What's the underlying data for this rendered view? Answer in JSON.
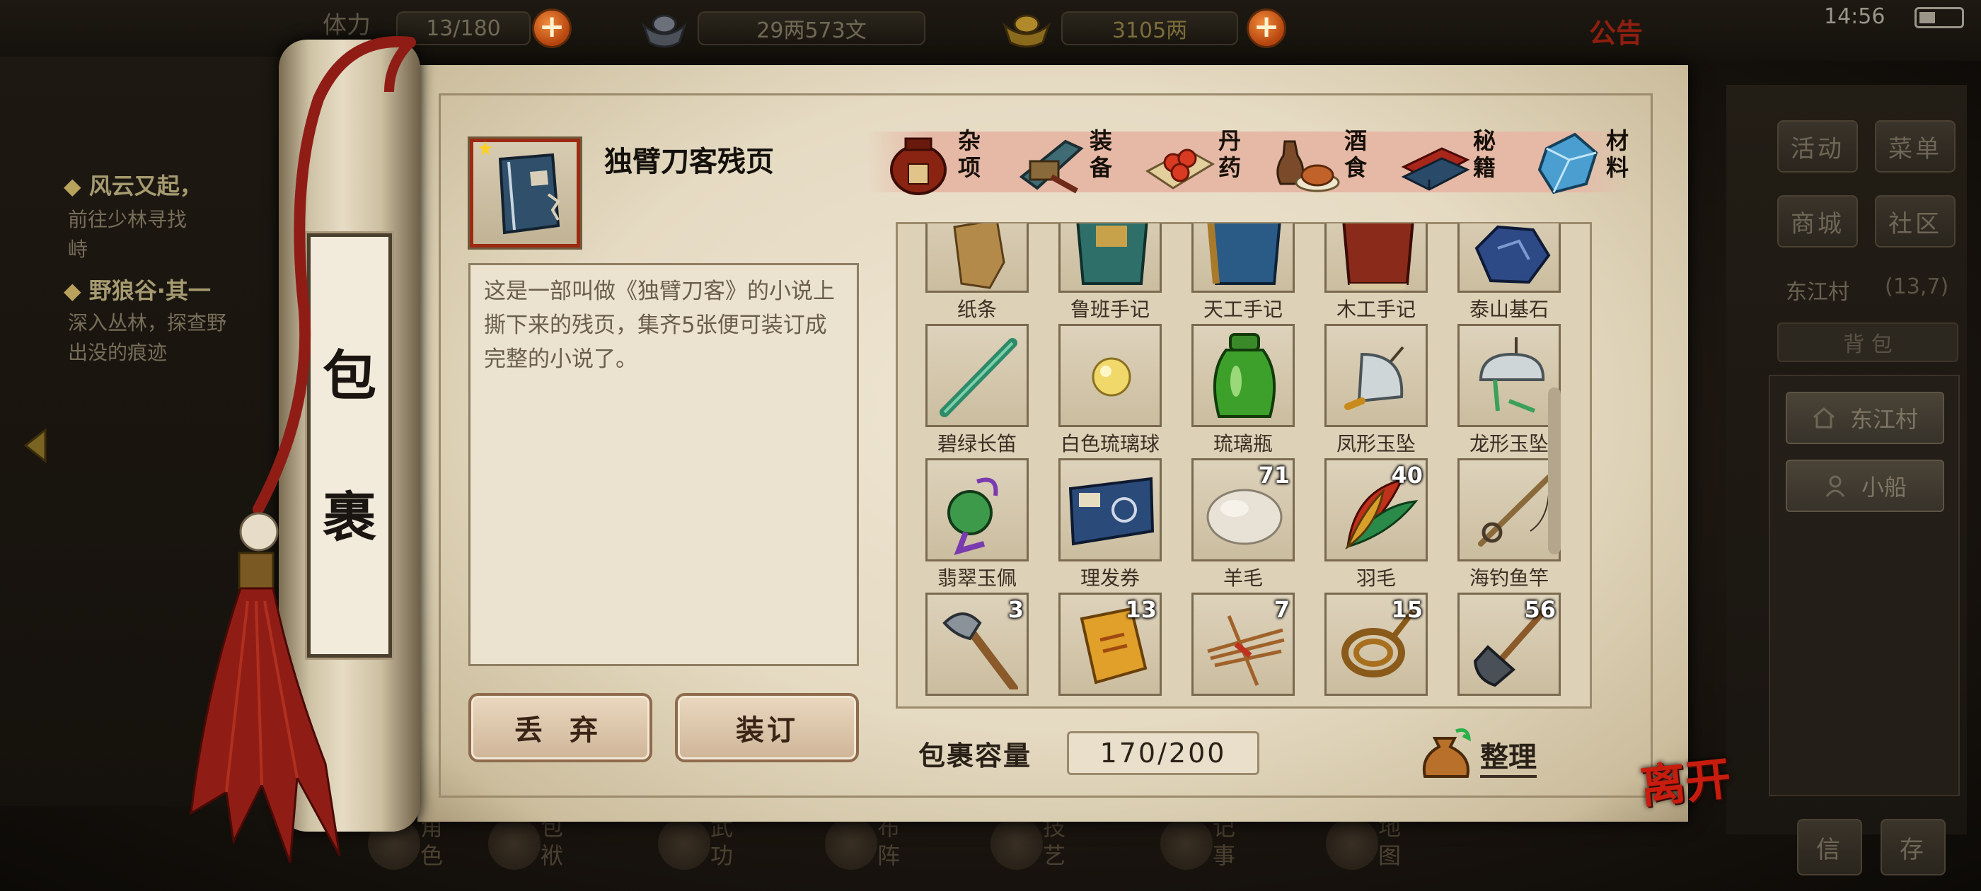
{
  "topbar": {
    "stamina_label": "体力",
    "stamina_value": "13/180",
    "silver_value": "29两573文",
    "gold_value": "3105两",
    "announcement": "公告",
    "time": "14:56"
  },
  "quests": [
    {
      "title": "风云又起，",
      "desc_lines": [
        "前往少林寻找",
        "峙"
      ]
    },
    {
      "title": "野狼谷·其一",
      "desc_lines": [
        "深入丛林，探查野",
        "出没的痕迹"
      ]
    }
  ],
  "side_panel": {
    "buttons": [
      "活动",
      "菜单",
      "商城",
      "社区"
    ],
    "location": "东江村",
    "coords": "(13,7)",
    "hint": "背 包",
    "places": [
      "东江村",
      "小船"
    ],
    "bottom_buttons": [
      "信",
      "存"
    ]
  },
  "bag": {
    "title_chars": [
      "包",
      "裹"
    ],
    "selected_item": {
      "name": "独臂刀客残页",
      "description": "这是一部叫做《独臂刀客》的小说上撕下来的残页，集齐5张便可装订成完整的小说了。"
    },
    "actions": {
      "discard": "丢 弃",
      "bind": "装订"
    },
    "tabs": [
      {
        "label": "杂项",
        "icon": "jar-icon",
        "active": true
      },
      {
        "label": "装备",
        "icon": "equipment-icon",
        "active": false
      },
      {
        "label": "丹药",
        "icon": "pills-icon",
        "active": false
      },
      {
        "label": "酒食",
        "icon": "wine-food-icon",
        "active": false
      },
      {
        "label": "秘籍",
        "icon": "books-icon",
        "active": false
      },
      {
        "label": "材料",
        "icon": "crystal-icon",
        "active": false
      }
    ],
    "items_row1": [
      {
        "name": "纸条",
        "icon": "paper-strip-icon",
        "qty": ""
      },
      {
        "name": "鲁班手记",
        "icon": "notebook-icon",
        "qty": ""
      },
      {
        "name": "天工手记",
        "icon": "notebook-icon",
        "qty": ""
      },
      {
        "name": "木工手记",
        "icon": "notebook-icon",
        "qty": ""
      },
      {
        "name": "泰山基石",
        "icon": "stone-icon",
        "qty": ""
      }
    ],
    "items_row2": [
      {
        "name": "碧绿长笛",
        "icon": "flute-icon",
        "qty": ""
      },
      {
        "name": "白色琉璃球",
        "icon": "glass-ball-icon",
        "qty": ""
      },
      {
        "name": "琉璃瓶",
        "icon": "green-bottle-icon",
        "qty": ""
      },
      {
        "name": "凤形玉坠",
        "icon": "phoenix-pendant-icon",
        "qty": ""
      },
      {
        "name": "龙形玉坠",
        "icon": "dragon-pendant-icon",
        "qty": ""
      }
    ],
    "items_row3": [
      {
        "name": "翡翠玉佩",
        "icon": "jade-pendant-icon",
        "qty": ""
      },
      {
        "name": "理发券",
        "icon": "ticket-icon",
        "qty": ""
      },
      {
        "name": "羊毛",
        "icon": "wool-icon",
        "qty": "71"
      },
      {
        "name": "羽毛",
        "icon": "feather-icon",
        "qty": "40"
      },
      {
        "name": "海钓鱼竿",
        "icon": "fishing-rod-icon",
        "qty": ""
      }
    ],
    "items_row4": [
      {
        "name": "",
        "icon": "axe-icon",
        "qty": "3"
      },
      {
        "name": "",
        "icon": "scroll-paper-icon",
        "qty": "13"
      },
      {
        "name": "",
        "icon": "sticks-icon",
        "qty": "7"
      },
      {
        "name": "",
        "icon": "rope-icon",
        "qty": "15"
      },
      {
        "name": "",
        "icon": "shovel-icon",
        "qty": "56"
      }
    ],
    "capacity_label": "包裹容量",
    "capacity_value": "170/200",
    "sort_label": "整理",
    "leave_label": "离开"
  },
  "bottom_nav": [
    "角色",
    "包袱",
    "武功",
    "布阵",
    "技艺",
    "记事",
    "地图"
  ],
  "colors": {
    "accent_red": "#c81d0e",
    "parchment": "#e5dac2",
    "tab_band": "#e6b8a6"
  }
}
